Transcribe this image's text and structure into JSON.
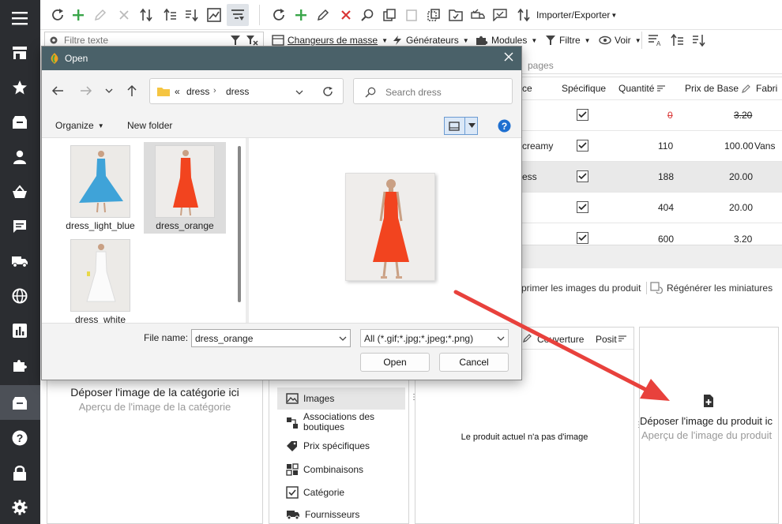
{
  "toolbar": {
    "importer": "Importer/Exporter",
    "filter_placeholder": "Filtre texte"
  },
  "toolbar2": {
    "changeurs": "Changeurs de masse",
    "generateurs": "Générateurs",
    "modules": "Modules",
    "filtre": "Filtre",
    "voir": "Voir"
  },
  "tabs": {
    "pages": "pages"
  },
  "grid": {
    "headers": {
      "ce": "ce",
      "specifique": "Spécifique",
      "quantite": "Quantité",
      "prix": "Prix de Base",
      "fab": "Fabri"
    },
    "rows": [
      {
        "name": "",
        "quantity": "0",
        "price": "3.20",
        "extra": "",
        "qty_red": true,
        "price_strike": true
      },
      {
        "name": "creamy",
        "quantity": "110",
        "price": "100.00",
        "extra": "Vans"
      },
      {
        "name": "ess",
        "quantity": "188",
        "price": "20.00",
        "extra": ""
      },
      {
        "name": "",
        "quantity": "404",
        "price": "20.00",
        "extra": ""
      },
      {
        "name": "",
        "quantity": "600",
        "price": "3.20",
        "extra": ""
      }
    ]
  },
  "image_actions": {
    "supprimer": "primer les images du produit",
    "regenerer": "Régénérer les miniatures"
  },
  "image_columns": {
    "couverture": "Couverture",
    "position": "Posit"
  },
  "category_drop": {
    "title": "Déposer l'image de la catégorie ici",
    "subtitle": "Aperçu de l'image de la catégorie"
  },
  "product_drop": {
    "title": "Déposer l'image du produit ic",
    "subtitle": "Aperçu de l'image du produit"
  },
  "no_image": "Le produit actuel n'a pas d'image",
  "menu": [
    {
      "label": "Images"
    },
    {
      "label": "Associations des boutiques"
    },
    {
      "label": "Prix spécifiques"
    },
    {
      "label": "Combinaisons"
    },
    {
      "label": "Catégorie"
    },
    {
      "label": "Fournisseurs"
    }
  ],
  "dialog": {
    "title": "Open",
    "breadcrumb": {
      "prefix": "«",
      "parts": [
        "dress",
        "dress"
      ]
    },
    "search_placeholder": "Search dress",
    "organize": "Organize",
    "new_folder": "New folder",
    "files": [
      {
        "name": "dress_light_blue",
        "color": "#3fa3d8"
      },
      {
        "name": "dress_orange",
        "color": "#f2441f"
      },
      {
        "name": "dress_white",
        "color": "#f4f4f4"
      }
    ],
    "file_name_label": "File name:",
    "file_name_value": "dress_orange",
    "file_type": "All (*.gif;*.jpg;*.jpeg;*.png)",
    "open_button": "Open",
    "cancel_button": "Cancel"
  },
  "colors": {
    "nav_bg": "#2b2d31",
    "title_bar": "#4a6169",
    "accent_arrow": "#e8413c",
    "check_green": "#3aa64a",
    "delete_red": "#d93636"
  }
}
